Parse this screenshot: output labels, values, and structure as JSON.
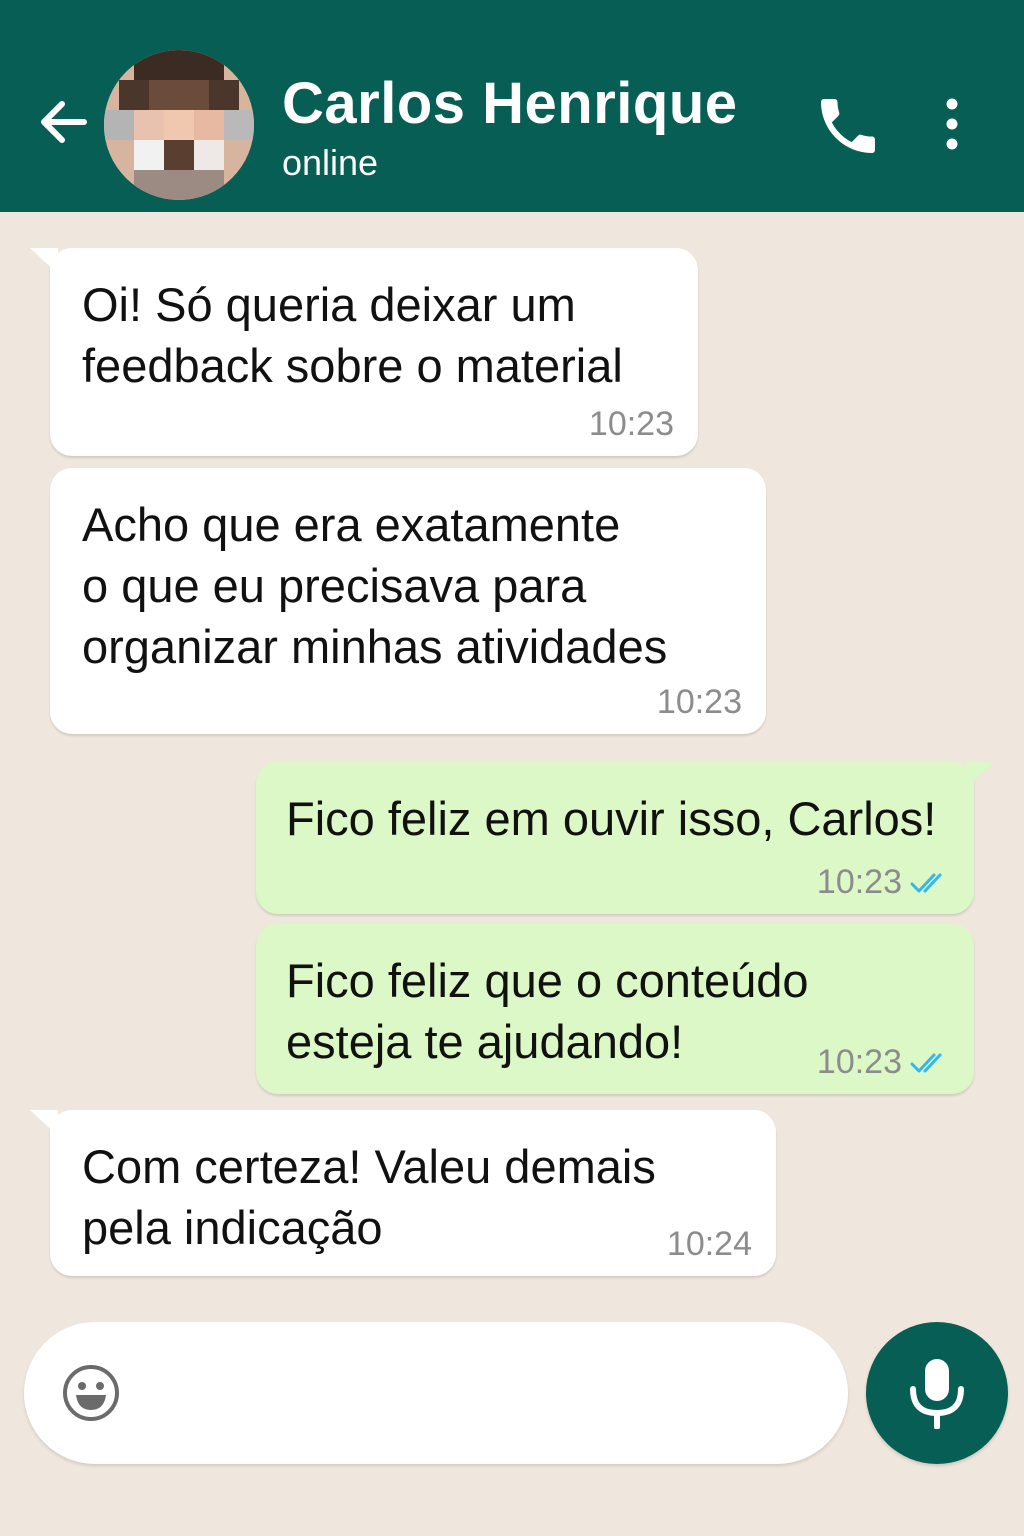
{
  "header": {
    "contact_name": "Carlos Henrique",
    "status": "online",
    "icons": {
      "back": "back-arrow-icon",
      "call": "phone-icon",
      "menu": "more-vertical-icon"
    },
    "colors": {
      "header_bg": "#075e54",
      "header_text": "#ffffff"
    }
  },
  "messages": [
    {
      "direction": "incoming",
      "text": "Oi! Só queria deixar um\nfeedback sobre o material",
      "time": "10:23"
    },
    {
      "direction": "incoming",
      "text": "Acho que era exatamente\no que eu precisava para\norganizar minhas atividades",
      "time": "10:23"
    },
    {
      "direction": "outgoing",
      "text": "Fico feliz em ouvir isso, Carlos!",
      "time": "10:23",
      "read": true
    },
    {
      "direction": "outgoing",
      "text": "Fico feliz que o conteúdo\nesteja te ajudando!",
      "time": "10:23",
      "read": true
    },
    {
      "direction": "incoming",
      "text": "Com certeza! Valeu demais\npela indicação",
      "time": "10:24"
    }
  ],
  "composer": {
    "placeholder": "",
    "value": "",
    "icons": {
      "emoji": "emoji-icon",
      "mic": "microphone-icon"
    }
  },
  "colors": {
    "chat_bg": "#efe7dd",
    "incoming_bubble": "#ffffff",
    "outgoing_bubble": "#dcf8c6",
    "read_ticks": "#34b7f1",
    "accent": "#075e54"
  }
}
